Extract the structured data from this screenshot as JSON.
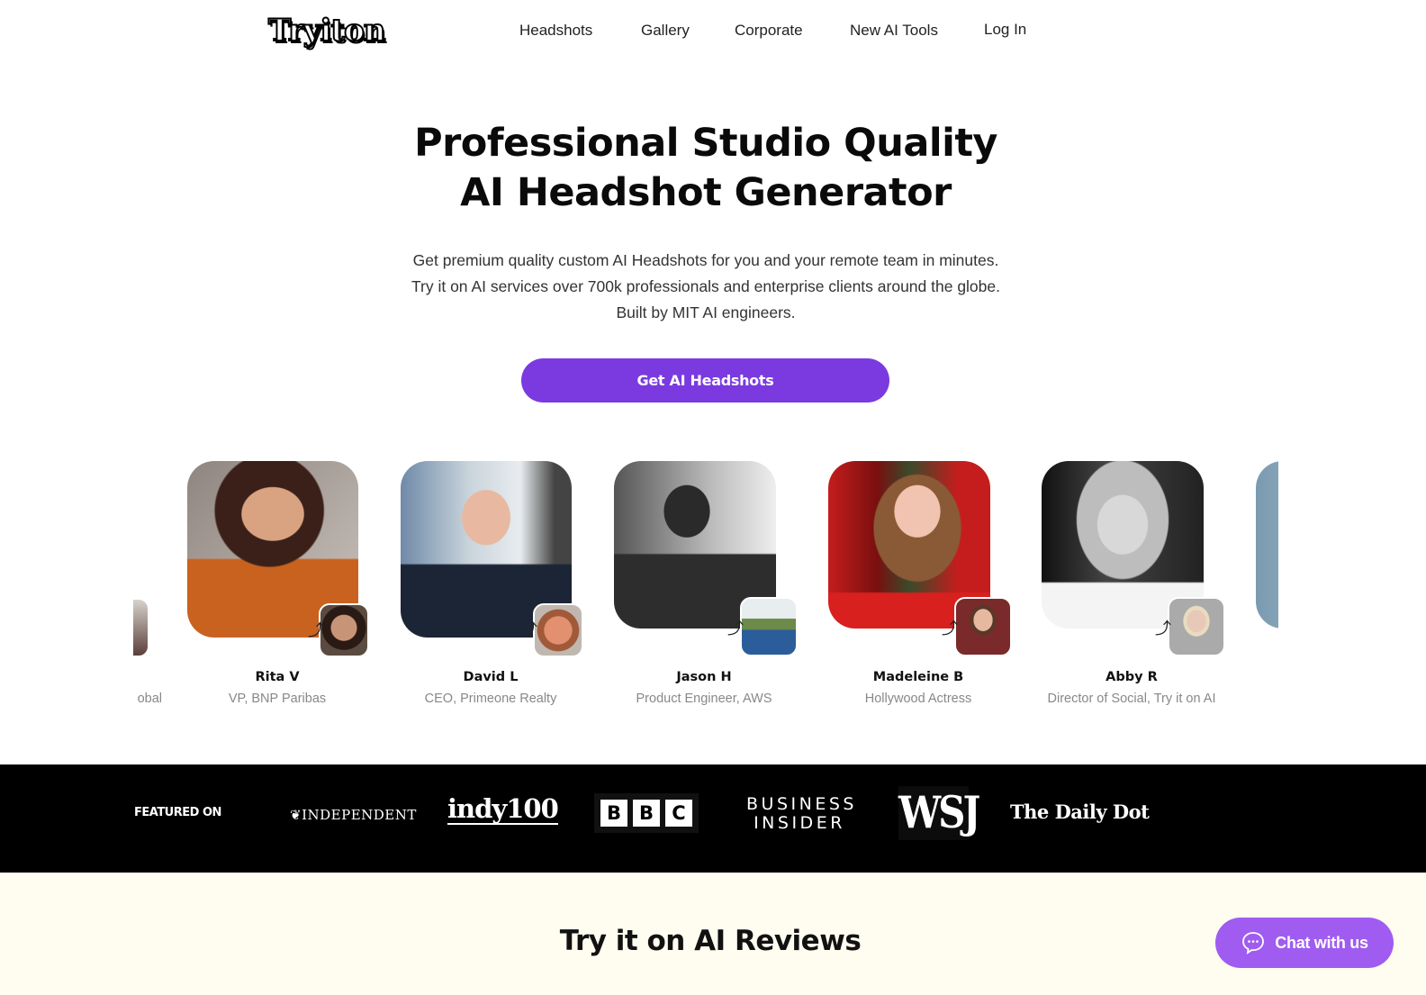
{
  "header": {
    "logo_text": "Tryiton",
    "nav": [
      {
        "label": "Headshots"
      },
      {
        "label": "Gallery"
      },
      {
        "label": "Corporate"
      },
      {
        "label": "New AI Tools"
      },
      {
        "label": "Log In"
      }
    ]
  },
  "hero": {
    "title_line1": "Professional Studio Quality",
    "title_line2": "AI Headshot Generator",
    "subtitle": "Get premium quality custom AI Headshots for you and your remote team in minutes. Try it on AI services over 700k professionals and enterprise clients around the globe. Built by MIT AI engineers.",
    "cta_label": "Get AI Headshots",
    "accent_color": "#7a3ae0"
  },
  "carousel": {
    "partial_left_role": "obal",
    "cards": [
      {
        "name": "Rita V",
        "role": "VP, BNP Paribas",
        "photo_desc": "woman in orange blouse, dark wavy hair, studio backdrop",
        "thumb_desc": "selfie of smiling woman"
      },
      {
        "name": "David L",
        "role": "CEO, Primeone Realty",
        "photo_desc": "man in dark suit and blue tie, city skyline background",
        "thumb_desc": "selfie of smiling man"
      },
      {
        "name": "Jason H",
        "role": "Product Engineer, AWS",
        "photo_desc": "black and white portrait of man in suit",
        "thumb_desc": "selfie of man in blue shirt outdoors"
      },
      {
        "name": "Madeleine B",
        "role": "Hollywood Actress",
        "photo_desc": "woman in red dress, red carpet background",
        "thumb_desc": "selfie of woman with long brown hair"
      },
      {
        "name": "Abby R",
        "role": "Director of Social, Try it on AI",
        "photo_desc": "black and white portrait of blonde woman",
        "thumb_desc": "selfie of blonde woman"
      }
    ]
  },
  "featured": {
    "label": "FEATURED ON",
    "outlets": [
      {
        "name": "INDEPENDENT"
      },
      {
        "name": "indy100"
      },
      {
        "name": "BBC",
        "letters": [
          "B",
          "B",
          "C"
        ]
      },
      {
        "name": "BUSINESS INSIDER",
        "line1": "BUSINESS",
        "line2": "INSIDER"
      },
      {
        "name": "WSJ"
      },
      {
        "name": "The Daily Dot"
      }
    ]
  },
  "reviews": {
    "title": "Try it on AI Reviews"
  },
  "chat": {
    "label": "Chat with us",
    "color": "#a05cf0"
  }
}
